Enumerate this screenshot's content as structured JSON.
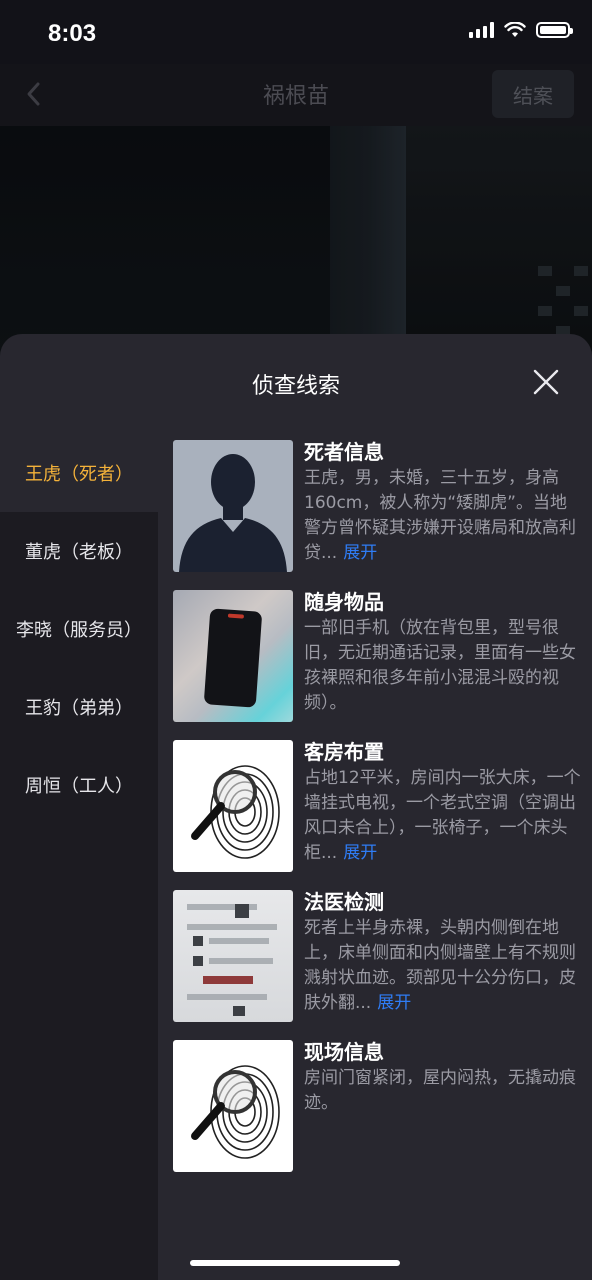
{
  "status": {
    "time": "8:03"
  },
  "nav": {
    "title": "祸根苗",
    "right_button": "结案"
  },
  "sheet": {
    "title": "侦查线索"
  },
  "sidebar": {
    "items": [
      {
        "label": "王虎（死者）",
        "active": true
      },
      {
        "label": "董虎（老板）",
        "active": false
      },
      {
        "label": "李晓（服务员）",
        "active": false
      },
      {
        "label": "王豹（弟弟）",
        "active": false
      },
      {
        "label": "周恒（工人）",
        "active": false
      }
    ]
  },
  "clues": [
    {
      "title": "死者信息",
      "text": "王虎，男，未婚，三十五岁，身高160cm，被人称为“矮脚虎”。当地警方曾怀疑其涉嫌开设赌局和放高利贷...",
      "expand": "展开",
      "thumb": "person-silhouette"
    },
    {
      "title": "随身物品",
      "text": "一部旧手机（放在背包里，型号很旧，无近期通话记录，里面有一些女孩裸照和很多年前小混混斗殴的视频）。",
      "expand": "",
      "thumb": "phone"
    },
    {
      "title": "客房布置",
      "text": "占地12平米，房间内一张大床，一个墙挂式电视，一个老式空调（空调出风口未合上），一张椅子，一个床头柜...",
      "expand": "展开",
      "thumb": "fingerprint-magnifier"
    },
    {
      "title": "法医检测",
      "text": "死者上半身赤裸，头朝内侧倒在地上，床单侧面和内侧墙壁上有不规则溅射状血迹。颈部见十公分伤口，皮肤外翻...",
      "expand": "展开",
      "thumb": "document"
    },
    {
      "title": "现场信息",
      "text": "房间门窗紧闭，屋内闷热，无撬动痕迹。",
      "expand": "",
      "thumb": "fingerprint-magnifier"
    }
  ],
  "colors": {
    "accent": "#f4b23a",
    "link": "#2f7df6",
    "sheet": "#28272f",
    "sidebar": "#1c1b21"
  }
}
